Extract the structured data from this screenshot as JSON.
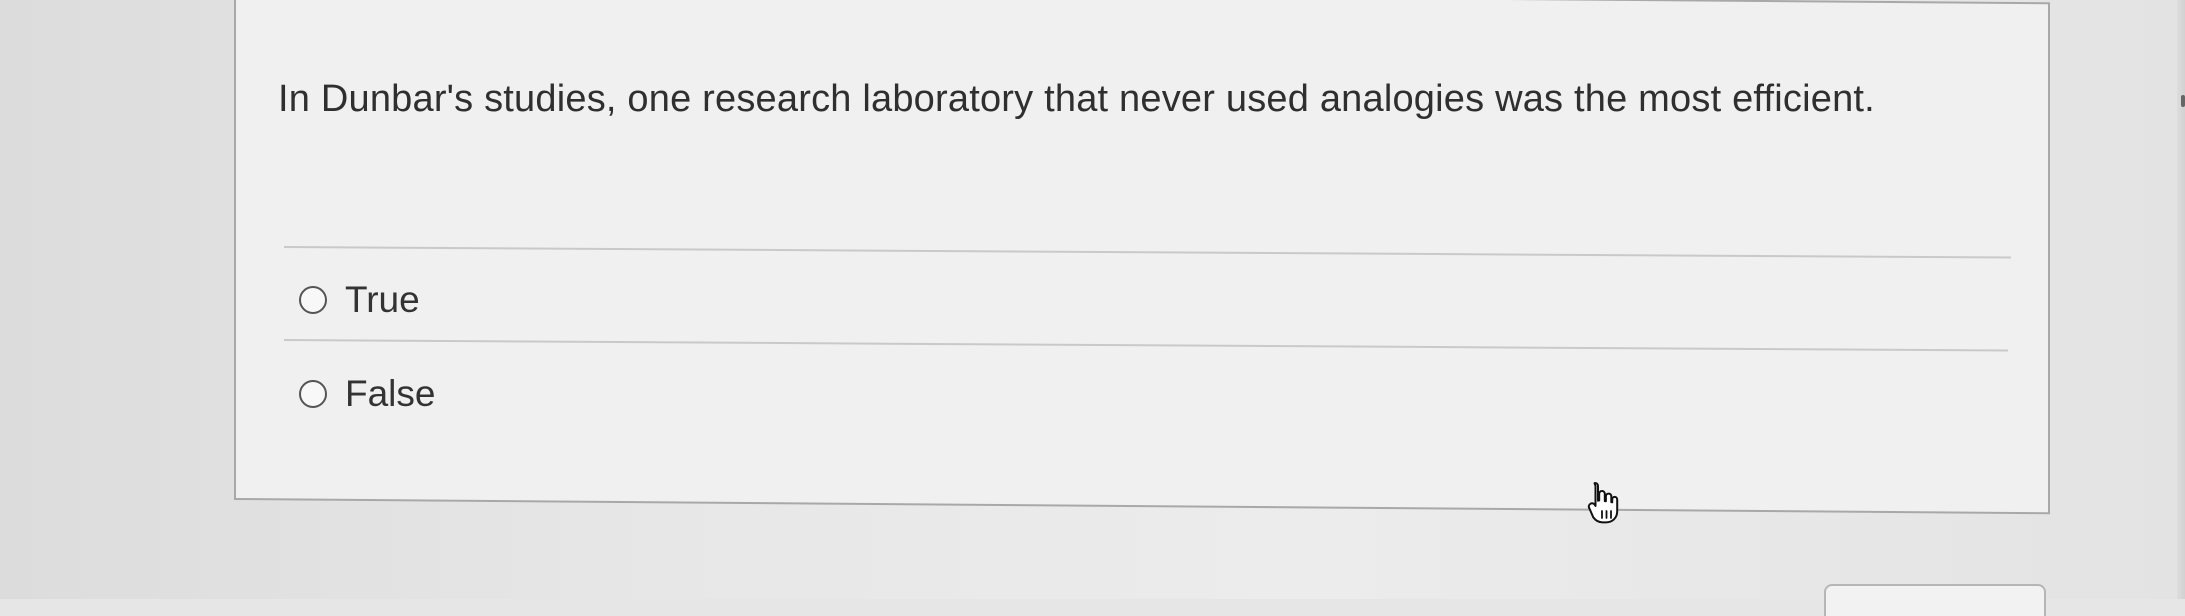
{
  "question": {
    "text": "In Dunbar's studies, one research laboratory that never used analogies was the most efficient."
  },
  "options": [
    {
      "label": "True",
      "selected": false
    },
    {
      "label": "False",
      "selected": false
    }
  ],
  "icons": {
    "radio": "radio-button-icon",
    "cursor": "pointer-hand-icon"
  },
  "colors": {
    "background": "#e6e6e6",
    "card_background": "#f0f0f0",
    "text": "#2f2f2f",
    "border": "#a8a8a8"
  }
}
